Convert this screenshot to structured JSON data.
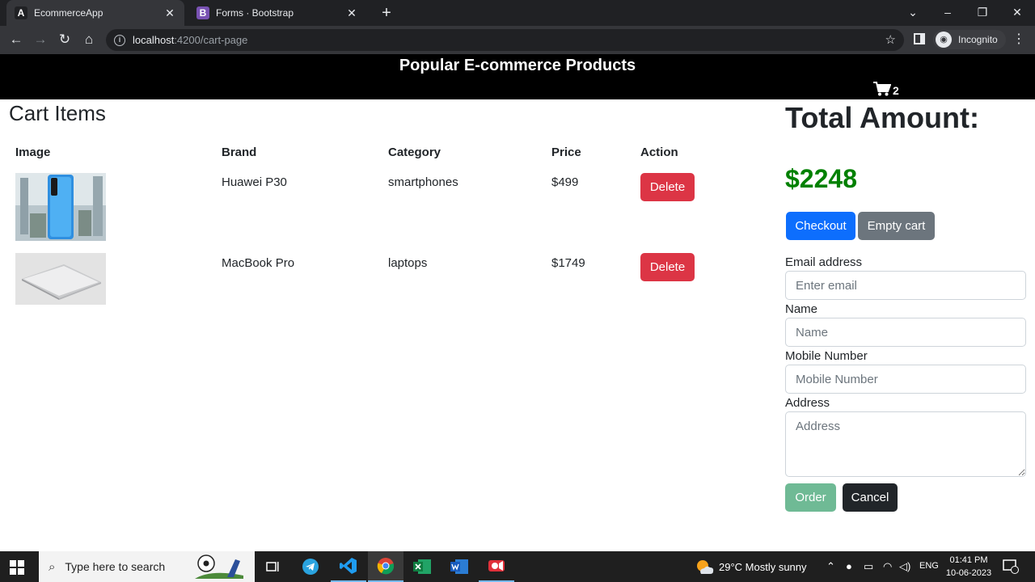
{
  "browser": {
    "tabs": [
      {
        "title": "EcommerceApp",
        "favicon": "A",
        "active": true
      },
      {
        "title": "Forms · Bootstrap",
        "favicon": "B",
        "active": false
      }
    ],
    "url_host": "localhost",
    "url_path": ":4200/cart-page",
    "profile_label": "Incognito"
  },
  "header": {
    "title": "Popular E-commerce Products",
    "cart_count": "2"
  },
  "cart": {
    "heading": "Cart Items",
    "columns": [
      "Image",
      "Brand",
      "Category",
      "Price",
      "Action"
    ],
    "rows": [
      {
        "brand": "Huawei P30",
        "category": "smartphones",
        "price": "$499",
        "action": "Delete",
        "image": "phone-image"
      },
      {
        "brand": "MacBook Pro",
        "category": "laptops",
        "price": "$1749",
        "action": "Delete",
        "image": "laptop-image"
      }
    ]
  },
  "summary": {
    "total_label": "Total Amount:",
    "total_value": "$2248",
    "checkout_label": "Checkout",
    "empty_label": "Empty cart"
  },
  "form": {
    "email_label": "Email address",
    "email_placeholder": "Enter email",
    "name_label": "Name",
    "name_placeholder": "Name",
    "mobile_label": "Mobile Number",
    "mobile_placeholder": "Mobile Number",
    "address_label": "Address",
    "address_placeholder": "Address",
    "order_label": "Order",
    "cancel_label": "Cancel"
  },
  "taskbar": {
    "search_placeholder": "Type here to search",
    "weather": "29°C  Mostly sunny",
    "language": "ENG",
    "time": "01:41 PM",
    "date": "10-06-2023"
  },
  "colors": {
    "header_bg": "#000000",
    "total_green": "#008000",
    "delete_red": "#dc3545",
    "checkout_blue": "#0d6efd",
    "empty_gray": "#6c757d",
    "order_green": "#6fba95",
    "cancel_dark": "#212529"
  }
}
